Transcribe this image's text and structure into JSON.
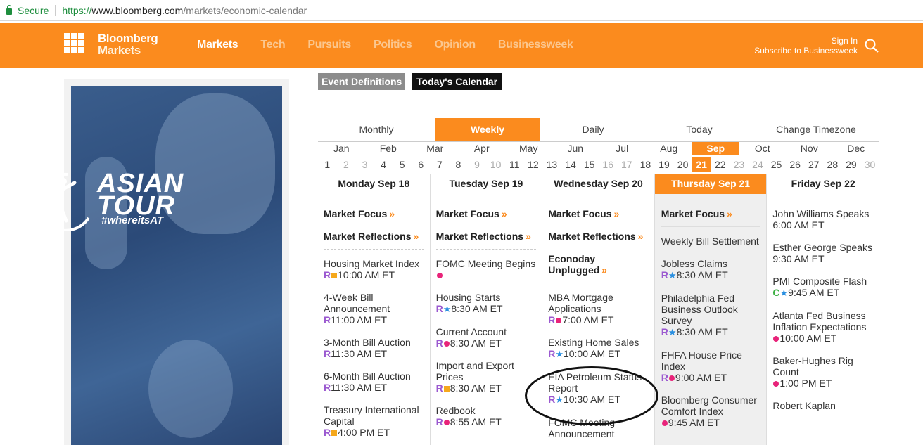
{
  "browser": {
    "secure_label": "Secure",
    "url_proto": "https://",
    "url_host": "www.bloomberg.com",
    "url_path": "/markets/economic-calendar"
  },
  "header": {
    "brand_line1": "Bloomberg",
    "brand_line2": "Markets",
    "nav": [
      "Markets",
      "Tech",
      "Pursuits",
      "Politics",
      "Opinion",
      "Businessweek"
    ],
    "active_nav": "Markets",
    "sign_in": "Sign In",
    "subscribe": "Subscribe to Businessweek",
    "accent_color": "#fb8b1e"
  },
  "ad": {
    "title_line1": "ASIAN",
    "title_line2": "TOUR",
    "hashtag": "#whereitsAT"
  },
  "buttons": {
    "definitions": "Event Definitions",
    "today_calendar": "Today's Calendar"
  },
  "view_tabs": [
    "Monthly",
    "Weekly",
    "Daily",
    "Today",
    "Change Timezone"
  ],
  "active_view": "Weekly",
  "months": [
    "Jan",
    "Feb",
    "Mar",
    "Apr",
    "May",
    "Jun",
    "Jul",
    "Aug",
    "Sep",
    "Oct",
    "Nov",
    "Dec"
  ],
  "active_month": "Sep",
  "days": [
    {
      "d": "1",
      "dim": false
    },
    {
      "d": "2",
      "dim": true
    },
    {
      "d": "3",
      "dim": true
    },
    {
      "d": "4",
      "dim": false
    },
    {
      "d": "5",
      "dim": false
    },
    {
      "d": "6",
      "dim": false
    },
    {
      "d": "7",
      "dim": false
    },
    {
      "d": "8",
      "dim": false
    },
    {
      "d": "9",
      "dim": true
    },
    {
      "d": "10",
      "dim": true
    },
    {
      "d": "11",
      "dim": false
    },
    {
      "d": "12",
      "dim": false
    },
    {
      "d": "13",
      "dim": false
    },
    {
      "d": "14",
      "dim": false
    },
    {
      "d": "15",
      "dim": false
    },
    {
      "d": "16",
      "dim": true
    },
    {
      "d": "17",
      "dim": true
    },
    {
      "d": "18",
      "dim": false
    },
    {
      "d": "19",
      "dim": false
    },
    {
      "d": "20",
      "dim": false
    },
    {
      "d": "21",
      "dim": false,
      "on": true
    },
    {
      "d": "22",
      "dim": false
    },
    {
      "d": "23",
      "dim": true
    },
    {
      "d": "24",
      "dim": true
    },
    {
      "d": "25",
      "dim": false
    },
    {
      "d": "26",
      "dim": false
    },
    {
      "d": "27",
      "dim": false
    },
    {
      "d": "28",
      "dim": false
    },
    {
      "d": "29",
      "dim": false
    },
    {
      "d": "30",
      "dim": true
    }
  ],
  "week": [
    {
      "title": "Monday Sep 18",
      "today": false,
      "focus": [
        "Market Focus",
        "Market Reflections"
      ],
      "events": [
        {
          "name": "Housing Market Index",
          "badges": [
            "R",
            "sq"
          ],
          "time": "10:00 AM ET"
        },
        {
          "name": "4-Week Bill Announcement",
          "badges": [
            "R"
          ],
          "time": "11:00 AM ET"
        },
        {
          "name": "3-Month Bill Auction",
          "badges": [
            "R"
          ],
          "time": "11:30 AM ET"
        },
        {
          "name": "6-Month Bill Auction",
          "badges": [
            "R"
          ],
          "time": "11:30 AM ET"
        },
        {
          "name": "Treasury International Capital",
          "badges": [
            "R",
            "sq"
          ],
          "time": "4:00 PM ET"
        }
      ]
    },
    {
      "title": "Tuesday Sep 19",
      "today": false,
      "focus": [
        "Market Focus",
        "Market Reflections"
      ],
      "events": [
        {
          "name": "FOMC Meeting Begins",
          "badges": [
            "dot"
          ],
          "time": "",
          "inline": true
        },
        {
          "name": "Housing Starts",
          "badges": [
            "R",
            "star"
          ],
          "time": "8:30 AM ET"
        },
        {
          "name": "Current Account",
          "badges": [
            "R",
            "dot"
          ],
          "time": "8:30 AM ET"
        },
        {
          "name": "Import and Export Prices",
          "badges": [
            "R",
            "sq"
          ],
          "time": "8:30 AM ET"
        },
        {
          "name": "Redbook",
          "badges": [
            "R",
            "dot"
          ],
          "time": "8:55 AM ET"
        }
      ]
    },
    {
      "title": "Wednesday Sep 20",
      "today": false,
      "focus": [
        "Market Focus",
        "Market Reflections",
        "Econoday Unplugged"
      ],
      "events": [
        {
          "name": "MBA Mortgage Applications",
          "badges": [
            "R",
            "dot"
          ],
          "time": "7:00 AM ET"
        },
        {
          "name": "Existing Home Sales",
          "badges": [
            "R",
            "star"
          ],
          "time": "10:00 AM ET"
        },
        {
          "name": "EIA Petroleum Status Report",
          "badges": [
            "R",
            "star"
          ],
          "time": "10:30 AM ET"
        },
        {
          "name": "FOMC Meeting Announcement",
          "badges": [],
          "time": ""
        }
      ]
    },
    {
      "title": "Thursday Sep 21",
      "today": true,
      "focus": [
        "Market Focus"
      ],
      "events": [
        {
          "name": "Weekly Bill Settlement",
          "badges": [],
          "time": ""
        },
        {
          "name": "Jobless Claims",
          "badges": [
            "R",
            "star"
          ],
          "time": "8:30 AM ET"
        },
        {
          "name": "Philadelphia Fed Business Outlook Survey",
          "badges": [
            "R",
            "star"
          ],
          "time": "8:30 AM ET"
        },
        {
          "name": "FHFA House Price Index",
          "badges": [
            "R",
            "dot"
          ],
          "time": "9:00 AM ET"
        },
        {
          "name": "Bloomberg Consumer Comfort Index",
          "badges": [
            "dot"
          ],
          "time": "9:45 AM ET"
        }
      ]
    },
    {
      "title": "Friday Sep 22",
      "today": false,
      "focus": [],
      "events": [
        {
          "name": "John Williams Speaks",
          "badges": [],
          "time": "6:00 AM ET"
        },
        {
          "name": "Esther George Speaks",
          "badges": [],
          "time": "9:30 AM ET"
        },
        {
          "name": "PMI Composite Flash",
          "badges": [
            "C",
            "star"
          ],
          "time": "9:45 AM ET"
        },
        {
          "name": "Atlanta Fed Business Inflation Expectations",
          "badges": [
            "dot"
          ],
          "time": "10:00 AM ET"
        },
        {
          "name": "Baker-Hughes Rig Count",
          "badges": [
            "dot"
          ],
          "time": "1:00 PM ET"
        },
        {
          "name": "Robert Kaplan",
          "badges": [],
          "time": ""
        }
      ]
    }
  ]
}
